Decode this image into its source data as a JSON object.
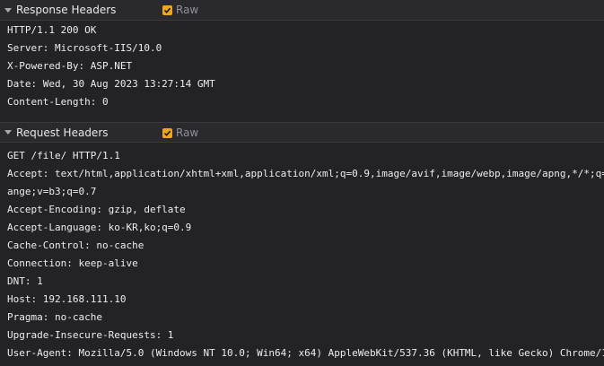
{
  "response_headers": {
    "title": "Response Headers",
    "raw_label": "Raw",
    "raw_checked": true,
    "lines": [
      "HTTP/1.1 200 OK",
      "Server: Microsoft-IIS/10.0",
      "X-Powered-By: ASP.NET",
      "Date: Wed, 30 Aug 2023 13:27:14 GMT",
      "Content-Length: 0"
    ]
  },
  "request_headers": {
    "title": "Request Headers",
    "raw_label": "Raw",
    "raw_checked": true,
    "lines": [
      "GET /file/ HTTP/1.1",
      "Accept: text/html,application/xhtml+xml,application/xml;q=0.9,image/avif,image/webp,image/apng,*/*;q=",
      "ange;v=b3;q=0.7",
      "Accept-Encoding: gzip, deflate",
      "Accept-Language: ko-KR,ko;q=0.9",
      "Cache-Control: no-cache",
      "Connection: keep-alive",
      "DNT: 1",
      "Host: 192.168.111.10",
      "Pragma: no-cache",
      "Upgrade-Insecure-Requests: 1",
      "User-Agent: Mozilla/5.0 (Windows NT 10.0; Win64; x64) AppleWebKit/537.36 (KHTML, like Gecko) Chrome/1"
    ]
  },
  "colors": {
    "accent_checkbox": "#f0a51e",
    "background": "#232327",
    "header_bar": "#2a2a2e",
    "text": "#ededf0"
  },
  "icons": {
    "section_toggle": "triangle-down-icon",
    "raw_check": "checkmark-icon"
  }
}
